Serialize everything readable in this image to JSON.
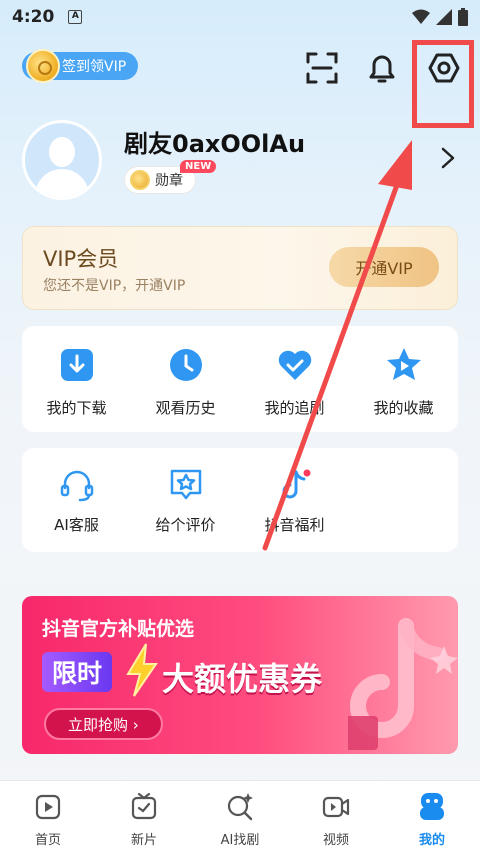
{
  "status_bar": {
    "time": "4:20",
    "notification_letter": "A"
  },
  "header": {
    "checkin_label": "签到领VIP"
  },
  "profile": {
    "username": "剧友0axOOlAu",
    "badge_label": "勋章",
    "new_tag": "NEW"
  },
  "vip": {
    "title": "VIP会员",
    "subtitle": "您还不是VIP，开通VIP",
    "button": "开通VIP"
  },
  "quick_grid": [
    {
      "label": "我的下载",
      "icon": "download-icon"
    },
    {
      "label": "观看历史",
      "icon": "clock-icon"
    },
    {
      "label": "我的追剧",
      "icon": "heart-icon"
    },
    {
      "label": "我的收藏",
      "icon": "star-icon"
    }
  ],
  "service_grid": [
    {
      "label": "AI客服",
      "icon": "headset-icon"
    },
    {
      "label": "给个评价",
      "icon": "rating-star-icon"
    },
    {
      "label": "抖音福利",
      "icon": "douyin-icon"
    }
  ],
  "banner": {
    "title": "抖音官方补贴优选",
    "flash": "限时",
    "big": "大额优惠券",
    "button": "立即抢购 ›"
  },
  "bottom_nav": [
    {
      "label": "首页",
      "icon": "home-play-icon"
    },
    {
      "label": "新片",
      "icon": "tv-icon"
    },
    {
      "label": "AI找剧",
      "icon": "ai-search-icon"
    },
    {
      "label": "视频",
      "icon": "video-camera-icon"
    },
    {
      "label": "我的",
      "icon": "profile-icon"
    }
  ],
  "colors": {
    "accent": "#1a8cf0",
    "highlight": "#f04a4a",
    "banner_pink": "#f7286b"
  }
}
